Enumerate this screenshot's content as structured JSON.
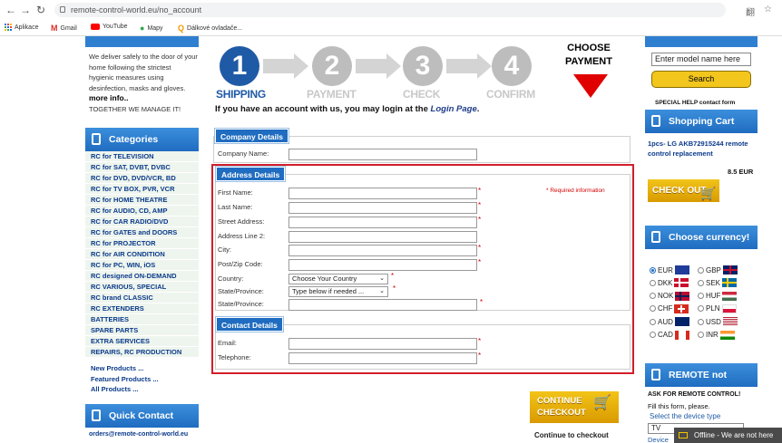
{
  "browser": {
    "back": "←",
    "forward": "→",
    "reload": "↻",
    "url": "remote-control-world.eu/no_account",
    "translate_icon": "翻",
    "star_icon": "☆"
  },
  "bookmarks": {
    "apps": "Aplikace",
    "gmail": "Gmail",
    "youtube": "YouTube",
    "maps": "Mapy",
    "remotes": "Dálkové ovladače..."
  },
  "left": {
    "intro_text": "We deliver safely to the door of your home following the strictest hygienic measures using desinfection, masks and gloves.",
    "more_info": "more info..",
    "together": "TOGETHER WE MANAGE IT!",
    "categories_title": "Categories",
    "categories": [
      "RC for TELEVISION",
      "RC for SAT, DVBT, DVBC",
      "RC for DVD, DVD/VCR, BD",
      "RC for TV BOX, PVR, VCR",
      "RC for HOME THEATRE",
      "RC for AUDIO, CD, AMP",
      "RC for CAR RADIO/DVD",
      "RC for GATES and DOORS",
      "RC for PROJECTOR",
      "RC for AIR CONDITION",
      "RC for PC, WIN, iOS",
      "RC designed ON-DEMAND",
      "RC VARIOUS, SPECIAL",
      "RC brand CLASSIC",
      "RC EXTENDERS",
      "BATTERIES",
      "SPARE PARTS",
      "EXTRA SERVICES",
      "REPAIRS, RC PRODUCTION"
    ],
    "product_links": [
      "New Products ...",
      "Featured Products ...",
      "All Products ..."
    ],
    "quick_contact_title": "Quick Contact",
    "email": "orders@remote-control-world.eu"
  },
  "steps": {
    "items": [
      {
        "num": "1",
        "label": "SHIPPING"
      },
      {
        "num": "2",
        "label": "PAYMENT"
      },
      {
        "num": "3",
        "label": "CHECK"
      },
      {
        "num": "4",
        "label": "CONFIRM"
      }
    ],
    "choose_line1": "CHOOSE",
    "choose_line2": "PAYMENT"
  },
  "login": {
    "text": "If you have an account with us, you may login at the ",
    "link": "Login Page",
    "end": "."
  },
  "form": {
    "company_legend": "Company Details",
    "company_label": "Company Name:",
    "address_legend": "Address Details",
    "required_info": "* Required information",
    "first_name": "First Name:",
    "last_name": "Last Name:",
    "street": "Street Address:",
    "address2": "Address Line 2:",
    "city": "City:",
    "zip": "Post/Zip Code:",
    "country": "Country:",
    "country_value": "Choose Your Country",
    "state_province": "State/Province:",
    "state_value": "Type below if needed ...",
    "state_province2": "State/Province:",
    "contact_legend": "Contact Details",
    "email": "Email:",
    "telephone": "Telephone:",
    "req_mark": "*"
  },
  "continue": {
    "line1": "CONTINUE",
    "line2": "CHECKOUT",
    "caption": "Continue to checkout"
  },
  "right": {
    "model_placeholder": "Enter model name here",
    "search": "Search",
    "special_help": "SPECIAL HELP contact form",
    "cart_title": "Shopping Cart",
    "cart_item": "1pcs- LG AKB72915244 remote control replacement",
    "cart_price": "8.5 EUR",
    "checkout": "CHECK OUT",
    "currency_title": "Choose currency!",
    "currencies": [
      {
        "code": "EUR",
        "selected": true
      },
      {
        "code": "GBP",
        "selected": false
      },
      {
        "code": "DKK",
        "selected": false
      },
      {
        "code": "SEK",
        "selected": false
      },
      {
        "code": "NOK",
        "selected": false
      },
      {
        "code": "HUF",
        "selected": false
      },
      {
        "code": "CHF",
        "selected": false
      },
      {
        "code": "PLN",
        "selected": false
      },
      {
        "code": "AUD",
        "selected": false
      },
      {
        "code": "USD",
        "selected": false
      },
      {
        "code": "CAD",
        "selected": false
      },
      {
        "code": "INR",
        "selected": false
      }
    ],
    "remote_title": "REMOTE not found?",
    "remote_line1": "ASK FOR REMOTE CONTROL!",
    "remote_line2": "Fill this form, please.",
    "remote_line3": "Select the device type",
    "device_value": "TV",
    "device_label": "Device",
    "offline": "Offline - We are not here"
  }
}
